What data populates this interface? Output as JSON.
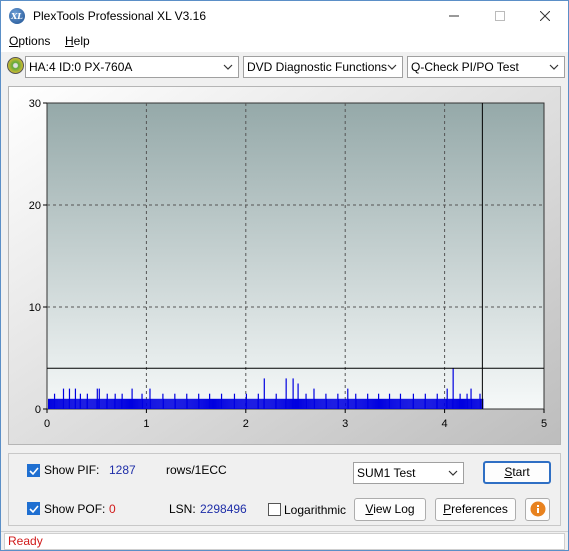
{
  "window": {
    "title": "PlexTools Professional XL V3.16",
    "icon_text": "XL"
  },
  "menu": {
    "options_first": "O",
    "options_rest": "ptions",
    "help_first": "H",
    "help_rest": "elp"
  },
  "toolbar": {
    "drive": "HA:4 ID:0  PX-760A",
    "function": "DVD Diagnostic Functions",
    "test": "Q-Check PI/PO Test"
  },
  "chart_data": {
    "type": "bar",
    "xlim": [
      0,
      5
    ],
    "ylim": [
      0,
      30
    ],
    "x_ticks": [
      "0",
      "1",
      "2",
      "3",
      "4",
      "5"
    ],
    "y_ticks": [
      "0",
      "10",
      "20",
      "30"
    ],
    "grid": true,
    "threshold": 4,
    "cursor_x": 4.38,
    "colors": {
      "bars": "#0000e0",
      "plot_top": "#95a9a9",
      "plot_bottom": "#f6f9f9",
      "grid": "#555555"
    },
    "base_level": 1,
    "spikes": [
      {
        "x": 0.07,
        "y": 1.5
      },
      {
        "x": 0.16,
        "y": 2
      },
      {
        "x": 0.22,
        "y": 2
      },
      {
        "x": 0.28,
        "y": 2
      },
      {
        "x": 0.33,
        "y": 1.5
      },
      {
        "x": 0.4,
        "y": 1.5
      },
      {
        "x": 0.5,
        "y": 2
      },
      {
        "x": 0.52,
        "y": 2
      },
      {
        "x": 0.6,
        "y": 1.5
      },
      {
        "x": 0.68,
        "y": 1.5
      },
      {
        "x": 0.75,
        "y": 1.5
      },
      {
        "x": 0.85,
        "y": 2
      },
      {
        "x": 0.95,
        "y": 1.5
      },
      {
        "x": 1.03,
        "y": 2
      },
      {
        "x": 1.16,
        "y": 1.5
      },
      {
        "x": 1.28,
        "y": 1.5
      },
      {
        "x": 1.4,
        "y": 1.5
      },
      {
        "x": 1.52,
        "y": 1.5
      },
      {
        "x": 1.63,
        "y": 1.5
      },
      {
        "x": 1.75,
        "y": 1.5
      },
      {
        "x": 1.88,
        "y": 1.5
      },
      {
        "x": 2.0,
        "y": 1.5
      },
      {
        "x": 2.12,
        "y": 1.5
      },
      {
        "x": 2.18,
        "y": 3
      },
      {
        "x": 2.3,
        "y": 1.5
      },
      {
        "x": 2.4,
        "y": 3
      },
      {
        "x": 2.47,
        "y": 3
      },
      {
        "x": 2.52,
        "y": 2.5
      },
      {
        "x": 2.6,
        "y": 1.5
      },
      {
        "x": 2.68,
        "y": 2
      },
      {
        "x": 2.8,
        "y": 1.5
      },
      {
        "x": 2.92,
        "y": 1.5
      },
      {
        "x": 3.02,
        "y": 2
      },
      {
        "x": 3.1,
        "y": 1.5
      },
      {
        "x": 3.22,
        "y": 1.5
      },
      {
        "x": 3.33,
        "y": 1.5
      },
      {
        "x": 3.44,
        "y": 1.5
      },
      {
        "x": 3.55,
        "y": 1.5
      },
      {
        "x": 3.68,
        "y": 1.5
      },
      {
        "x": 3.8,
        "y": 1.5
      },
      {
        "x": 3.92,
        "y": 1.5
      },
      {
        "x": 4.02,
        "y": 2
      },
      {
        "x": 4.08,
        "y": 4
      },
      {
        "x": 4.15,
        "y": 1.5
      },
      {
        "x": 4.22,
        "y": 1.5
      },
      {
        "x": 4.26,
        "y": 2
      },
      {
        "x": 4.35,
        "y": 1.5
      }
    ]
  },
  "controls": {
    "show_pif_label": "Show PIF:",
    "pif_value": "1287",
    "pif_unit": "rows/1ECC",
    "show_pof_label": "Show POF:",
    "pof_value": "0",
    "lsn_label": "LSN:",
    "lsn_value": "2298496",
    "logarithmic_label": "Logarithmic",
    "sum_test": "SUM1 Test",
    "start_first": "S",
    "start_rest": "tart",
    "viewlog_first": "V",
    "viewlog_rest": "iew Log",
    "prefs_first": "P",
    "prefs_rest": "references"
  },
  "status": {
    "text": "Ready"
  }
}
